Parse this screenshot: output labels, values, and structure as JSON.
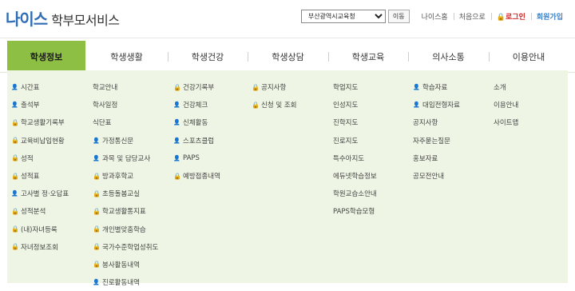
{
  "logo": {
    "brand": "나이스",
    "subtitle": "학부모서비스"
  },
  "util": {
    "region_selected": "부산광역시교육청",
    "go_label": "이동",
    "links": [
      "나이스홈",
      "처음으로",
      "로그인",
      "회원가입"
    ]
  },
  "tabs": [
    "학생정보",
    "학생생활",
    "학생건강",
    "학생상담",
    "학생교육",
    "의사소통",
    "이용안내"
  ],
  "active_tab": "학생정보",
  "colors": {
    "active_tab": "#8dbf45",
    "panel_bg": "#eef5e4",
    "login": "#d42424",
    "join": "#3a7fc9",
    "brand": "#2f6db5"
  },
  "columns": [
    [
      {
        "label": "시간표",
        "icon": "person-icon"
      },
      {
        "label": "출석부",
        "icon": "person-icon"
      },
      {
        "label": "학교생활기록부",
        "icon": "lock-icon"
      },
      {
        "label": "교육비납입현황",
        "icon": "lock-icon"
      },
      {
        "label": "성적",
        "icon": "lock-icon"
      },
      {
        "label": "성적표",
        "icon": "lock-icon"
      },
      {
        "label": "고사별 정·오답표",
        "icon": "person-icon"
      },
      {
        "label": "성적분석",
        "icon": "lock-icon"
      },
      {
        "label": "(내)자녀등록",
        "icon": "lock-icon"
      },
      {
        "label": "자녀정보조회",
        "icon": "lock-icon"
      }
    ],
    [
      {
        "label": "학교안내",
        "icon": ""
      },
      {
        "label": "학사일정",
        "icon": ""
      },
      {
        "label": "식단표",
        "icon": ""
      },
      {
        "label": "가정통신문",
        "icon": "person-icon"
      },
      {
        "label": "과목 및 담당교사",
        "icon": "person-icon"
      },
      {
        "label": "방과후학교",
        "icon": "lock-icon"
      },
      {
        "label": "초등돌봄교실",
        "icon": "lock-icon"
      },
      {
        "label": "학교생활통지표",
        "icon": "lock-icon"
      },
      {
        "label": "개인별맞춤학습",
        "icon": "lock-icon"
      },
      {
        "label": "국가수준학업성취도",
        "icon": "lock-icon"
      },
      {
        "label": "봉사활동내역",
        "icon": "lock-icon"
      },
      {
        "label": "진로활동내역",
        "icon": "person-icon"
      }
    ],
    [
      {
        "label": "건강기록부",
        "icon": "lock-icon"
      },
      {
        "label": "건강체크",
        "icon": "person-icon"
      },
      {
        "label": "신체활동",
        "icon": "person-icon"
      },
      {
        "label": "스포츠클럽",
        "icon": "person-icon"
      },
      {
        "label": "PAPS",
        "icon": "person-icon"
      },
      {
        "label": "예방접종내역",
        "icon": "lock-icon"
      }
    ],
    [
      {
        "label": "공지사항",
        "icon": "lock-icon"
      },
      {
        "label": "신청 및 조회",
        "icon": "lock-icon"
      }
    ],
    [
      {
        "label": "학업지도",
        "icon": ""
      },
      {
        "label": "인성지도",
        "icon": ""
      },
      {
        "label": "진학지도",
        "icon": ""
      },
      {
        "label": "진로지도",
        "icon": ""
      },
      {
        "label": "특수아지도",
        "icon": ""
      },
      {
        "label": "에듀넷학습정보",
        "icon": ""
      },
      {
        "label": "학원교습소안내",
        "icon": ""
      },
      {
        "label": "PAPS학습모형",
        "icon": ""
      }
    ],
    [
      {
        "label": "학습자료",
        "icon": "person-icon"
      },
      {
        "label": "대입전형자료",
        "icon": "person-icon"
      },
      {
        "label": "공지사항",
        "icon": ""
      },
      {
        "label": "자주묻는질문",
        "icon": ""
      },
      {
        "label": "홍보자료",
        "icon": ""
      },
      {
        "label": "공모전안내",
        "icon": ""
      }
    ],
    [
      {
        "label": "소개",
        "icon": ""
      },
      {
        "label": "이용안내",
        "icon": ""
      },
      {
        "label": "사이트맵",
        "icon": ""
      }
    ]
  ]
}
